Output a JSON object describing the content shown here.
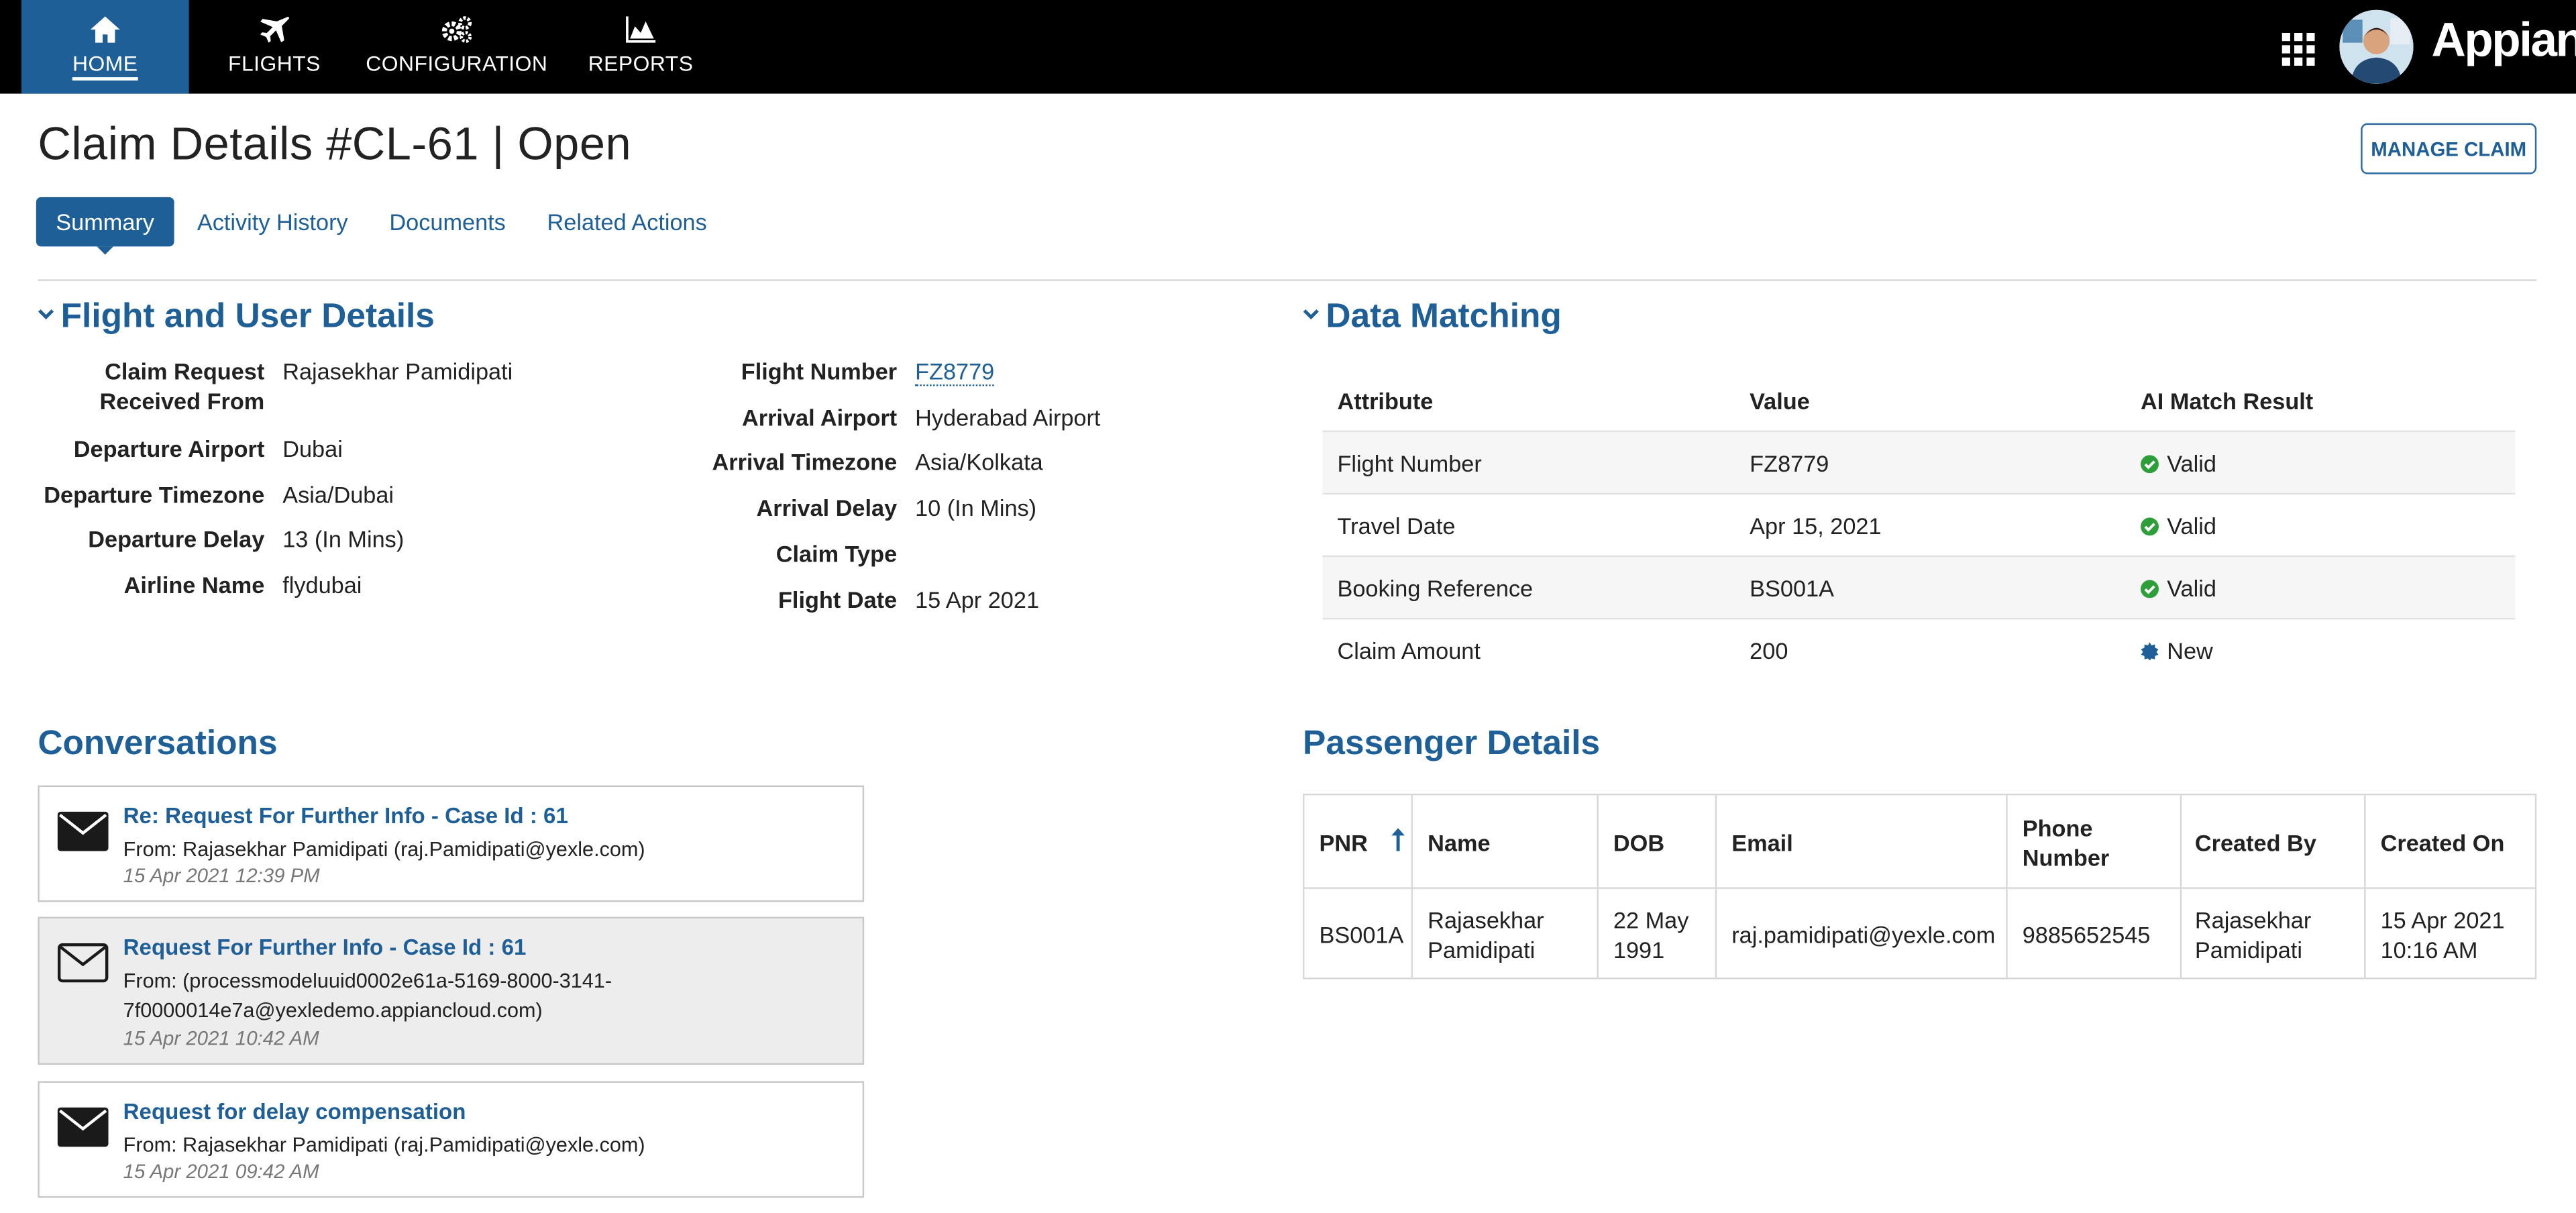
{
  "nav": {
    "items": [
      {
        "label": "HOME",
        "icon": "home-icon"
      },
      {
        "label": "FLIGHTS",
        "icon": "airplane-icon"
      },
      {
        "label": "CONFIGURATION",
        "icon": "gears-icon"
      },
      {
        "label": "REPORTS",
        "icon": "area-chart-icon"
      }
    ],
    "brand": "Appian"
  },
  "header": {
    "title": "Claim Details #CL-61 | Open",
    "manage_label": "MANAGE CLAIM"
  },
  "tabs": [
    {
      "label": "Summary",
      "active": true
    },
    {
      "label": "Activity History"
    },
    {
      "label": "Documents"
    },
    {
      "label": "Related Actions"
    }
  ],
  "flight": {
    "title": "Flight and User Details",
    "left": [
      {
        "label": "Claim Request Received From",
        "value": "Rajasekhar Pamidipati"
      },
      {
        "label": "Departure Airport",
        "value": "Dubai"
      },
      {
        "label": "Departure Timezone",
        "value": "Asia/Dubai"
      },
      {
        "label": "Departure Delay",
        "value": "13 (In Mins)"
      },
      {
        "label": "Airline Name",
        "value": "flydubai"
      }
    ],
    "right": [
      {
        "label": "Flight Number",
        "value": "FZ8779"
      },
      {
        "label": "Arrival Airport",
        "value": "Hyderabad Airport"
      },
      {
        "label": "Arrival Timezone",
        "value": "Asia/Kolkata"
      },
      {
        "label": "Arrival Delay",
        "value": "10 (In Mins)"
      },
      {
        "label": "Claim Type",
        "value": ""
      },
      {
        "label": "Flight Date",
        "value": "15 Apr 2021"
      }
    ]
  },
  "matching": {
    "title": "Data Matching",
    "headers": [
      "Attribute",
      "Value",
      "AI Match Result"
    ],
    "rows": [
      {
        "attribute": "Flight Number",
        "value": "FZ8779",
        "result": "Valid",
        "status_color": "#2e9e3b"
      },
      {
        "attribute": "Travel Date",
        "value": "Apr 15, 2021",
        "result": "Valid",
        "status_color": "#2e9e3b"
      },
      {
        "attribute": "Booking Reference",
        "value": "BS001A",
        "result": "Valid",
        "status_color": "#2e9e3b"
      },
      {
        "attribute": "Claim Amount",
        "value": "200",
        "result": "New",
        "status_color": "#1d5f96"
      }
    ]
  },
  "conversations": {
    "title": "Conversations",
    "items": [
      {
        "subject": "Re: Request For Further Info - Case Id : 61",
        "from": "From: Rajasekhar Pamidipati (raj.Pamidipati@yexle.com)",
        "time": "15 Apr 2021 12:39 PM"
      },
      {
        "subject": "Request For Further Info - Case Id : 61",
        "from": "From: (processmodeluuid0002e61a-5169-8000-3141-7f0000014e7a@yexledemo.appiancloud.com)",
        "time": "15 Apr 2021 10:42 AM"
      },
      {
        "subject": "Request for delay compensation",
        "from": "From: Rajasekhar Pamidipati (raj.Pamidipati@yexle.com)",
        "time": "15 Apr 2021 09:42 AM"
      }
    ]
  },
  "passenger": {
    "title": "Passenger Details",
    "headers": [
      "PNR",
      "Name",
      "DOB",
      "Email",
      "Phone Number",
      "Created By",
      "Created On"
    ],
    "row": [
      "BS001A",
      "Rajasekhar Pamidipati",
      "22 May 1991",
      "raj.pamidipati@yexle.com",
      "9885652545",
      "Rajasekhar Pamidipati",
      "15 Apr 2021 10:16 AM"
    ]
  },
  "colors": {
    "accent": "#1d5f96",
    "valid": "#2e9e3b",
    "topbar": "#000000"
  }
}
